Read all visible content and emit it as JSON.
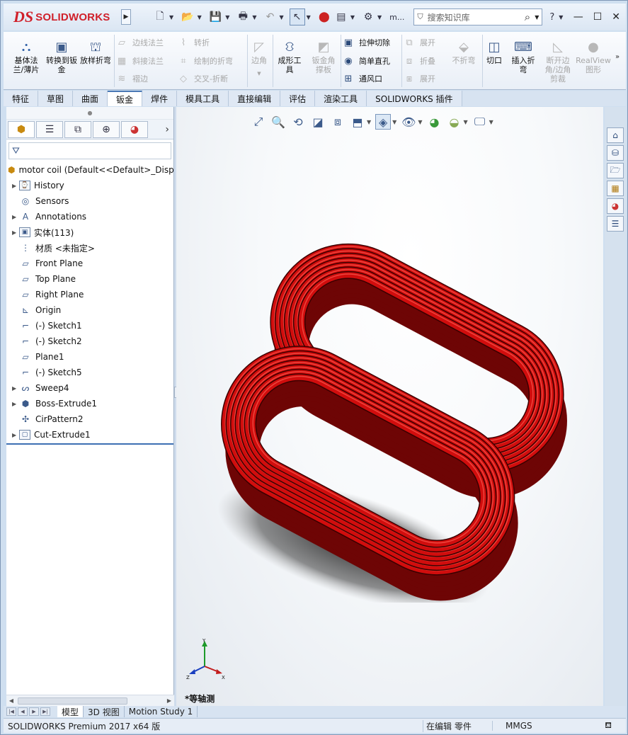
{
  "app": {
    "logo_prefix": "DS",
    "logo_text": "SOLIDWORKS",
    "search_placeholder": "搜索知识库",
    "help_label": "?"
  },
  "quick_access": {
    "more_label": "m..."
  },
  "ribbon": {
    "big_buttons": [
      {
        "label": "基体法兰/薄片",
        "icon": "base-flange-icon",
        "enabled": true
      },
      {
        "label": "转换到钣金",
        "icon": "convert-to-sheet-metal-icon",
        "enabled": true
      },
      {
        "label": "放样折弯",
        "icon": "lofted-bend-icon",
        "enabled": true
      }
    ],
    "small_col1": [
      {
        "label": "边线法兰",
        "enabled": false
      },
      {
        "label": "斜接法兰",
        "enabled": false
      },
      {
        "label": "褶边",
        "enabled": false
      }
    ],
    "small_col2": [
      {
        "label": "转折",
        "enabled": false
      },
      {
        "label": "绘制的折弯",
        "enabled": false
      },
      {
        "label": "交叉-折断",
        "enabled": false
      }
    ],
    "corner": {
      "label": "边角",
      "enabled": false
    },
    "forming_tool": {
      "label": "成形工具",
      "enabled": true
    },
    "gusset": {
      "label": "钣金角撑板",
      "enabled": false
    },
    "small_col3": [
      {
        "label": "拉伸切除",
        "enabled": true
      },
      {
        "label": "简单直孔",
        "enabled": true
      },
      {
        "label": "通风口",
        "enabled": true
      }
    ],
    "small_col4": [
      {
        "label": "展开",
        "enabled": false
      },
      {
        "label": "折叠",
        "enabled": false
      },
      {
        "label": "展开",
        "enabled": false
      }
    ],
    "no_bends": {
      "label": "不折弯",
      "enabled": false
    },
    "rip": {
      "label": "切口",
      "enabled": true
    },
    "insert_bends": {
      "label": "插入折弯",
      "enabled": true
    },
    "break_corner": {
      "label": "断开边角/边角剪裁",
      "enabled": false
    },
    "realview": {
      "label": "RealView图形",
      "enabled": false
    }
  },
  "tabs": [
    "特征",
    "草图",
    "曲面",
    "钣金",
    "焊件",
    "模具工具",
    "直接编辑",
    "评估",
    "渲染工具",
    "SOLIDWORKS 插件"
  ],
  "active_tab": "钣金",
  "feature_tree": {
    "root": "motor coil  (Default<<Default>_Disp",
    "items": [
      {
        "label": "History",
        "icon": "history-icon",
        "expandable": true
      },
      {
        "label": "Sensors",
        "icon": "sensors-icon",
        "expandable": false
      },
      {
        "label": "Annotations",
        "icon": "annotations-icon",
        "expandable": true
      },
      {
        "label": "实体(113)",
        "icon": "solid-bodies-icon",
        "expandable": true
      },
      {
        "label": "材质 <未指定>",
        "icon": "material-icon",
        "expandable": false
      },
      {
        "label": "Front Plane",
        "icon": "plane-icon",
        "expandable": false
      },
      {
        "label": "Top Plane",
        "icon": "plane-icon",
        "expandable": false
      },
      {
        "label": "Right Plane",
        "icon": "plane-icon",
        "expandable": false
      },
      {
        "label": "Origin",
        "icon": "origin-icon",
        "expandable": false
      },
      {
        "label": "(-) Sketch1",
        "icon": "sketch-icon",
        "expandable": false
      },
      {
        "label": "(-) Sketch2",
        "icon": "sketch-icon",
        "expandable": false
      },
      {
        "label": "Plane1",
        "icon": "plane-icon",
        "expandable": false
      },
      {
        "label": "(-) Sketch5",
        "icon": "sketch-icon",
        "expandable": false
      },
      {
        "label": "Sweep4",
        "icon": "sweep-icon",
        "expandable": true
      },
      {
        "label": "Boss-Extrude1",
        "icon": "boss-extrude-icon",
        "expandable": true
      },
      {
        "label": "CirPattern2",
        "icon": "circular-pattern-icon",
        "expandable": false
      },
      {
        "label": "Cut-Extrude1",
        "icon": "cut-extrude-icon",
        "expandable": true
      }
    ]
  },
  "viewport": {
    "view_label": "*等轴测",
    "axes": {
      "x": "X",
      "y": "Y",
      "z": "Z"
    },
    "coil_color": "#d10d0d"
  },
  "bottom_tabs": [
    "模型",
    "3D 视图",
    "Motion Study 1"
  ],
  "status": {
    "product": "SOLIDWORKS Premium 2017 x64 版",
    "mode": "在编辑 零件",
    "units": "MMGS"
  }
}
